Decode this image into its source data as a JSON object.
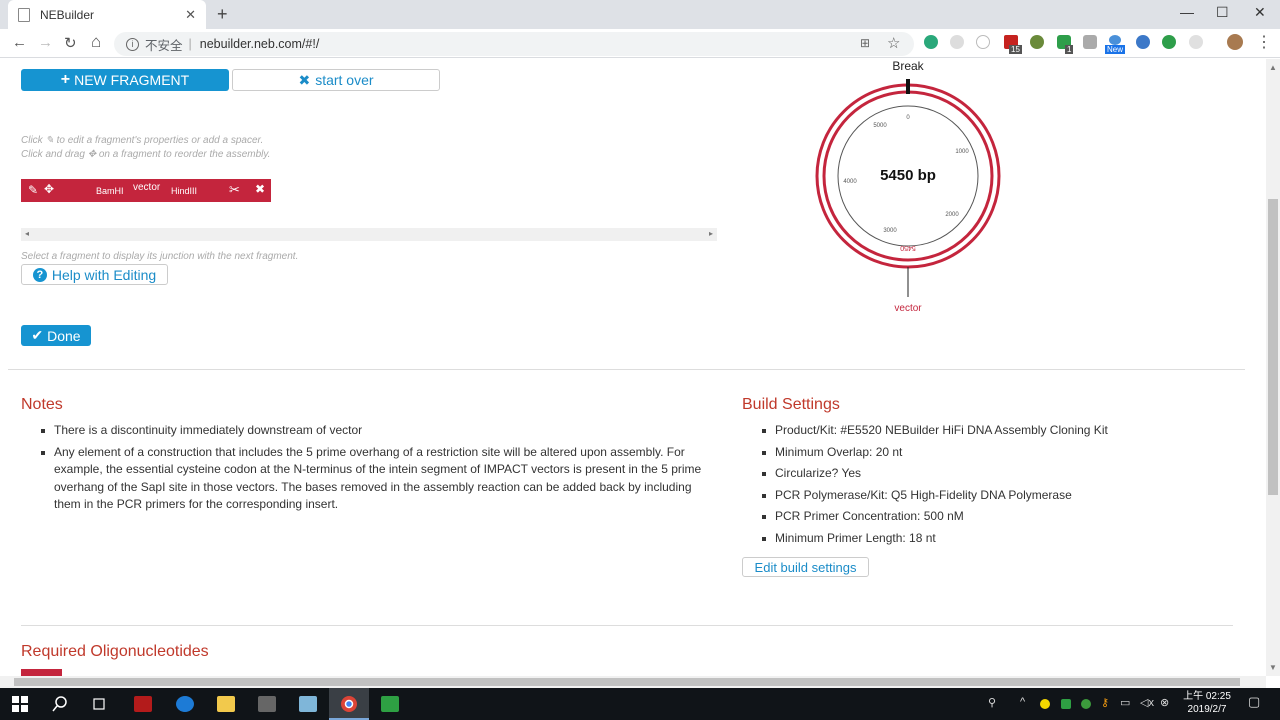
{
  "browser": {
    "tab_title": "NEBuilder",
    "tab_close": "✕",
    "new_tab": "+",
    "window_min": "—",
    "window_max": "☐",
    "window_close": "✕",
    "back": "←",
    "forward": "→",
    "reload": "↻",
    "home": "⌂",
    "info": "i",
    "insecure_label": "不安全",
    "separator": "|",
    "url": "nebuilder.neb.com/#!/",
    "menu": "⋮",
    "translate": "⊞",
    "star": "☆",
    "ext_badge_15": "15",
    "ext_badge_1": "1",
    "ext_badge_new": "New"
  },
  "toolbar": {
    "new_fragment_label": "NEW FRAGMENT",
    "new_fragment_icon": "+",
    "start_over_label": "start over",
    "start_over_icon": "✖"
  },
  "hints": {
    "edit_hint_pre": "Click",
    "edit_hint_post": "to edit a fragment's properties or add a spacer.",
    "drag_hint_pre": "Click and drag",
    "drag_hint_post": "on a fragment to reorder the assembly.",
    "junction_hint": "Select a fragment to display its junction with the next fragment."
  },
  "fragment": {
    "left_site": "BamHI",
    "name": "vector",
    "right_site": "HindIII",
    "edit_icon": "✎",
    "move_icon": "✥",
    "cut_icon": "✂",
    "delete_icon": "✖"
  },
  "scroller": {
    "left": "◂",
    "right": "▸"
  },
  "help_label": "Help with Editing",
  "help_icon": "?",
  "done_label": "Done",
  "done_icon": "✔",
  "plasmid": {
    "break_label": "Break",
    "size_label": "5450 bp",
    "fragment_label": "vector",
    "ticks": [
      "0",
      "1000",
      "2000",
      "3000",
      "4000",
      "5000"
    ],
    "bottom_tick": "5450",
    "accent": "#c4253d"
  },
  "notes": {
    "title": "Notes",
    "items": [
      "There is a discontinuity immediately downstream of vector",
      "Any element of a construction that includes the 5 prime overhang of a restriction site will be altered upon assembly. For example, the essential cysteine codon at the N-terminus of the intein segment of IMPACT vectors is present in the 5 prime overhang of the SapI site in those vectors. The bases removed in the assembly reaction can be added back by including them in the PCR primers for the corresponding insert."
    ]
  },
  "build_settings": {
    "title": "Build Settings",
    "items": [
      "Product/Kit: #E5520 NEBuilder HiFi DNA Assembly Cloning Kit",
      "Minimum Overlap: 20 nt",
      "Circularize? Yes",
      "PCR Polymerase/Kit: Q5 High-Fidelity DNA Polymerase",
      "PCR Primer Concentration: 500 nM",
      "Minimum Primer Length: 18 nt"
    ],
    "edit_label": "Edit build settings"
  },
  "oligos_title": "Required Oligonucleotides",
  "taskbar": {
    "time": "02:25",
    "ampm": "上午",
    "date": "2019/2/7"
  },
  "colors": {
    "accent_red": "#c4253d",
    "brand_blue": "#1694d1",
    "title_red": "#c0392b"
  }
}
